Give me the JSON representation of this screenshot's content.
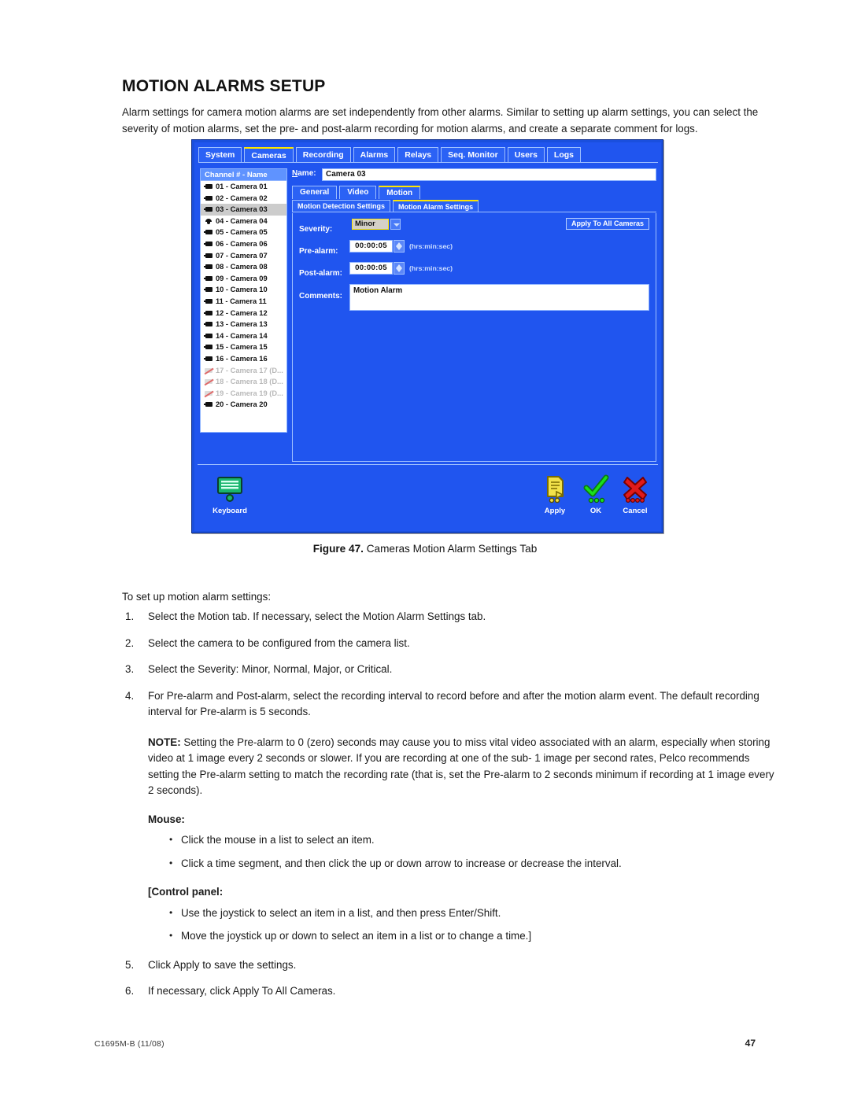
{
  "document": {
    "title": "MOTION ALARMS SETUP",
    "intro": "Alarm settings for camera motion alarms are set independently from other alarms. Similar to setting up alarm settings, you can select the severity of motion alarms, set the pre- and post-alarm recording for motion alarms, and create a separate comment for logs.",
    "figure_label": "Figure 47.",
    "figure_caption": "Cameras Motion Alarm Settings Tab",
    "lead_in": "To set up motion alarm settings:",
    "steps": [
      {
        "num": "1.",
        "text": "Select the Motion tab. If necessary, select the Motion Alarm Settings tab."
      },
      {
        "num": "2.",
        "text": "Select the camera to be configured from the camera list."
      },
      {
        "num": "3.",
        "text": "Select the Severity: Minor, Normal, Major, or Critical."
      },
      {
        "num": "4.",
        "text": "For Pre-alarm and Post-alarm, select the recording interval to record before and after the motion alarm event. The default recording interval for Pre-alarm is 5 seconds."
      }
    ],
    "note_label": "NOTE:",
    "note_text": "Setting the Pre-alarm to 0 (zero) seconds may cause you to miss vital video associated with an alarm, especially when storing video at 1 image every 2 seconds or slower. If you are recording at one of the sub- 1 image per second rates, Pelco recommends setting the Pre-alarm setting to match the recording rate (that is, set the Pre-alarm to 2 seconds minimum if recording at 1 image every 2 seconds).",
    "mouse_heading": "Mouse:",
    "mouse_bullets": [
      "Click the mouse in a list to select an item.",
      "Click a time segment, and then click the up or down arrow to increase or decrease the interval."
    ],
    "control_panel_bracket": "[",
    "control_panel_heading": "Control panel:",
    "control_panel_bullets": [
      "Use the joystick to select an item in a list, and then press Enter/Shift.",
      "Move the joystick up or down to select an item in a list or to change a time.]"
    ],
    "steps_tail": [
      {
        "num": "5.",
        "text": "Click Apply to save the settings."
      },
      {
        "num": "6.",
        "text": "If necessary, click Apply To All Cameras."
      }
    ],
    "footer_left": "C1695M-B  (11/08)",
    "footer_right": "47"
  },
  "screenshot": {
    "colors": {
      "window_bg": "#2055ef",
      "tab_border": "#9fc0ff",
      "active_tab_accent": "#ffe600",
      "list_selected": "#cccccc",
      "apply_icon": "#f2e14a",
      "ok_icon": "#19c21c",
      "cancel_icon": "#e01b1b"
    },
    "main_tabs": [
      {
        "label": "System",
        "active": false
      },
      {
        "label": "Cameras",
        "active": true
      },
      {
        "label": "Recording",
        "active": false
      },
      {
        "label": "Alarms",
        "active": false
      },
      {
        "label": "Relays",
        "active": false
      },
      {
        "label": "Seq. Monitor",
        "active": false
      },
      {
        "label": "Users",
        "active": false
      },
      {
        "label": "Logs",
        "active": false
      }
    ],
    "camera_list": {
      "header": "Channel # - Name",
      "rows": [
        {
          "label": "01 - Camera 01",
          "icon": "fixed-camera-icon",
          "state": "normal"
        },
        {
          "label": "02 - Camera 02",
          "icon": "fixed-camera-icon",
          "state": "normal"
        },
        {
          "label": "03 - Camera 03",
          "icon": "fixed-camera-icon",
          "state": "selected"
        },
        {
          "label": "04 - Camera 04",
          "icon": "dome-camera-icon",
          "state": "normal"
        },
        {
          "label": "05 - Camera 05",
          "icon": "fixed-camera-icon",
          "state": "normal"
        },
        {
          "label": "06 - Camera 06",
          "icon": "fixed-camera-icon",
          "state": "normal"
        },
        {
          "label": "07 - Camera 07",
          "icon": "fixed-camera-icon",
          "state": "normal"
        },
        {
          "label": "08 - Camera 08",
          "icon": "fixed-camera-icon",
          "state": "normal"
        },
        {
          "label": "09 - Camera 09",
          "icon": "fixed-camera-icon",
          "state": "normal"
        },
        {
          "label": "10 - Camera 10",
          "icon": "fixed-camera-icon",
          "state": "normal"
        },
        {
          "label": "11 - Camera 11",
          "icon": "fixed-camera-icon",
          "state": "normal"
        },
        {
          "label": "12 - Camera 12",
          "icon": "fixed-camera-icon",
          "state": "normal"
        },
        {
          "label": "13 - Camera 13",
          "icon": "fixed-camera-icon",
          "state": "normal"
        },
        {
          "label": "14 - Camera 14",
          "icon": "fixed-camera-icon",
          "state": "normal"
        },
        {
          "label": "15 - Camera 15",
          "icon": "fixed-camera-icon",
          "state": "normal"
        },
        {
          "label": "16 - Camera 16",
          "icon": "fixed-camera-icon",
          "state": "normal"
        },
        {
          "label": "17 - Camera 17 (D...",
          "icon": "disabled-camera-icon",
          "state": "disabled"
        },
        {
          "label": "18 - Camera 18 (D...",
          "icon": "disabled-camera-icon",
          "state": "disabled"
        },
        {
          "label": "19 - Camera 19 (D...",
          "icon": "disabled-camera-icon",
          "state": "disabled"
        },
        {
          "label": "20 - Camera 20",
          "icon": "fixed-camera-icon",
          "state": "normal"
        }
      ]
    },
    "name_field": {
      "label": "Name:",
      "value": "Camera 03"
    },
    "sub_tabs": [
      {
        "label": "General",
        "active": false
      },
      {
        "label": "Video",
        "active": false
      },
      {
        "label": "Motion",
        "active": true
      }
    ],
    "motion_tabs": [
      {
        "label": "Motion Detection Settings",
        "active": false
      },
      {
        "label": "Motion Alarm Settings",
        "active": true
      }
    ],
    "form": {
      "severity_label": "Severity:",
      "severity_value": "Minor",
      "severity_options": [
        "Minor",
        "Normal",
        "Major",
        "Critical"
      ],
      "prealarm_label": "Pre-alarm:",
      "prealarm_value": "00:00:05",
      "prealarm_hint": "(hrs:min:sec)",
      "postalarm_label": "Post-alarm:",
      "postalarm_value": "00:00:05",
      "postalarm_hint": "(hrs:min:sec)",
      "comments_label": "Comments:",
      "comments_value": "Motion Alarm",
      "apply_all_label": "Apply To All Cameras"
    },
    "bottom_bar": {
      "keyboard_label": "Keyboard",
      "apply_label": "Apply",
      "ok_label": "OK",
      "cancel_label": "Cancel"
    }
  }
}
